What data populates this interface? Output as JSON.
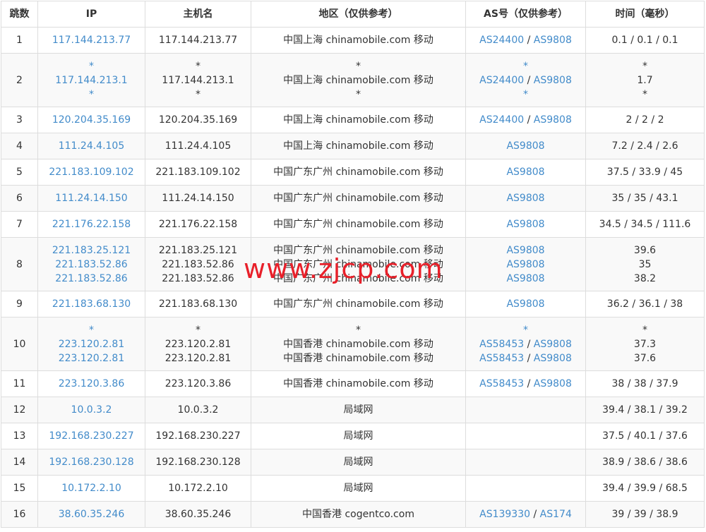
{
  "headers": [
    "跳数",
    "IP",
    "主机名",
    "地区（仅供参考）",
    "AS号（仅供参考）",
    "时间（毫秒）"
  ],
  "rows": [
    {
      "hop": "1",
      "lines": [
        {
          "ip": "117.144.213.77",
          "host": "117.144.213.77",
          "region": "中国上海 chinamobile.com 移动",
          "as": [
            "AS24400",
            "AS9808"
          ],
          "time": "0.1 / 0.1 / 0.1"
        }
      ]
    },
    {
      "hop": "2",
      "lines": [
        {
          "ip": "*",
          "host": "*",
          "region": "*",
          "as": [
            "*"
          ],
          "time": "*"
        },
        {
          "ip": "117.144.213.1",
          "host": "117.144.213.1",
          "region": "中国上海 chinamobile.com 移动",
          "as": [
            "AS24400",
            "AS9808"
          ],
          "time": "1.7"
        },
        {
          "ip": "*",
          "host": "*",
          "region": "*",
          "as": [
            "*"
          ],
          "time": "*"
        }
      ]
    },
    {
      "hop": "3",
      "lines": [
        {
          "ip": "120.204.35.169",
          "host": "120.204.35.169",
          "region": "中国上海 chinamobile.com 移动",
          "as": [
            "AS24400",
            "AS9808"
          ],
          "time": "2 / 2 / 2"
        }
      ]
    },
    {
      "hop": "4",
      "lines": [
        {
          "ip": "111.24.4.105",
          "host": "111.24.4.105",
          "region": "中国上海 chinamobile.com 移动",
          "as": [
            "AS9808"
          ],
          "time": "7.2 / 2.4 / 2.6"
        }
      ]
    },
    {
      "hop": "5",
      "lines": [
        {
          "ip": "221.183.109.102",
          "host": "221.183.109.102",
          "region": "中国广东广州 chinamobile.com 移动",
          "as": [
            "AS9808"
          ],
          "time": "37.5 / 33.9 / 45"
        }
      ]
    },
    {
      "hop": "6",
      "lines": [
        {
          "ip": "111.24.14.150",
          "host": "111.24.14.150",
          "region": "中国广东广州 chinamobile.com 移动",
          "as": [
            "AS9808"
          ],
          "time": "35 / 35 / 43.1"
        }
      ]
    },
    {
      "hop": "7",
      "lines": [
        {
          "ip": "221.176.22.158",
          "host": "221.176.22.158",
          "region": "中国广东广州 chinamobile.com 移动",
          "as": [
            "AS9808"
          ],
          "time": "34.5 / 34.5 / 111.6"
        }
      ]
    },
    {
      "hop": "8",
      "lines": [
        {
          "ip": "221.183.25.121",
          "host": "221.183.25.121",
          "region": "中国广东广州 chinamobile.com 移动",
          "as": [
            "AS9808"
          ],
          "time": "39.6"
        },
        {
          "ip": "221.183.52.86",
          "host": "221.183.52.86",
          "region": "中国广东广州 chinamobile.com 移动",
          "as": [
            "AS9808"
          ],
          "time": "35"
        },
        {
          "ip": "221.183.52.86",
          "host": "221.183.52.86",
          "region": "中国广东广州 chinamobile.com 移动",
          "as": [
            "AS9808"
          ],
          "time": "38.2"
        }
      ]
    },
    {
      "hop": "9",
      "lines": [
        {
          "ip": "221.183.68.130",
          "host": "221.183.68.130",
          "region": "中国广东广州 chinamobile.com 移动",
          "as": [
            "AS9808"
          ],
          "time": "36.2 / 36.1 / 38"
        }
      ]
    },
    {
      "hop": "10",
      "lines": [
        {
          "ip": "*",
          "host": "*",
          "region": "*",
          "as": [
            "*"
          ],
          "time": "*"
        },
        {
          "ip": "223.120.2.81",
          "host": "223.120.2.81",
          "region": "中国香港 chinamobile.com 移动",
          "as": [
            "AS58453",
            "AS9808"
          ],
          "time": "37.3"
        },
        {
          "ip": "223.120.2.81",
          "host": "223.120.2.81",
          "region": "中国香港 chinamobile.com 移动",
          "as": [
            "AS58453",
            "AS9808"
          ],
          "time": "37.6"
        }
      ]
    },
    {
      "hop": "11",
      "lines": [
        {
          "ip": "223.120.3.86",
          "host": "223.120.3.86",
          "region": "中国香港 chinamobile.com 移动",
          "as": [
            "AS58453",
            "AS9808"
          ],
          "time": "38 / 38 / 37.9"
        }
      ]
    },
    {
      "hop": "12",
      "lines": [
        {
          "ip": "10.0.3.2",
          "host": "10.0.3.2",
          "region": "局域网",
          "as": [],
          "time": "39.4 / 38.1 / 39.2"
        }
      ]
    },
    {
      "hop": "13",
      "lines": [
        {
          "ip": "192.168.230.227",
          "host": "192.168.230.227",
          "region": "局域网",
          "as": [],
          "time": "37.5 / 40.1 / 37.6"
        }
      ]
    },
    {
      "hop": "14",
      "lines": [
        {
          "ip": "192.168.230.128",
          "host": "192.168.230.128",
          "region": "局域网",
          "as": [],
          "time": "38.9 / 38.6 / 38.6"
        }
      ]
    },
    {
      "hop": "15",
      "lines": [
        {
          "ip": "10.172.2.10",
          "host": "10.172.2.10",
          "region": "局域网",
          "as": [],
          "time": "39.4 / 39.9 / 68.5"
        }
      ]
    },
    {
      "hop": "16",
      "lines": [
        {
          "ip": "38.60.35.246",
          "host": "38.60.35.246",
          "region": "中国香港 cogentco.com",
          "as": [
            "AS139330",
            "AS174"
          ],
          "time": "39 / 39 / 38.9"
        }
      ]
    }
  ],
  "watermark": "www.zjcp.com",
  "colors": {
    "link": "#428bca",
    "border": "#dddddd",
    "alt_row": "#f9f9f9",
    "watermark": "#e8202a"
  }
}
